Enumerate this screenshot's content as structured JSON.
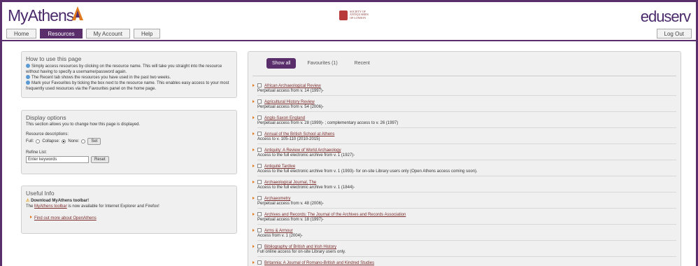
{
  "header": {
    "logo_text": "MyAthens",
    "society_lines": [
      "SOCIETY OF",
      "ANTIQUARIES",
      "OF LONDON"
    ],
    "eduserv_text": "eduserv"
  },
  "nav": {
    "tabs": [
      {
        "label": "Home",
        "active": false
      },
      {
        "label": "Resources",
        "active": true
      },
      {
        "label": "My Account",
        "active": false
      },
      {
        "label": "Help",
        "active": false
      }
    ],
    "logout_label": "Log Out"
  },
  "how_to": {
    "title": "How to use this page",
    "items": [
      "Simply access resources by clicking on the resource name. This will take you straight into the resource without having to specify a username/password again.",
      "The Recent tab shows the resources you have used in the past two weeks.",
      "Mark your Favourites by ticking the box next to the resource name. This enables easy access to your most frequently used resources via the Favourites panel on the home page."
    ]
  },
  "display_options": {
    "title": "Display options",
    "subtitle": "This section allows you to change how this page is displayed.",
    "descriptions_label": "Resource descriptions:",
    "full_label": "Full:",
    "collapse_label": "Collapse:",
    "none_label": "None:",
    "set_button": "Set",
    "refine_label": "Refine List:",
    "refine_placeholder": "Enter keywords",
    "reset_button": "Reset"
  },
  "useful_info": {
    "title": "Useful Info",
    "download_title": "Download MyAthens toolbar!",
    "toolbar_line_prefix": "The ",
    "toolbar_link": "MyAthens toolbar",
    "toolbar_line_suffix": " is now available for Internet Explorer and Firefox!",
    "find_out_link": "Find out more about OpenAthens"
  },
  "resources": {
    "tabs": [
      {
        "label": "Show all",
        "active": true
      },
      {
        "label": "Favourites (1)",
        "active": false
      },
      {
        "label": "Recent",
        "active": false
      }
    ],
    "items": [
      {
        "title": "African Archaeological Review",
        "desc": "Perpetual access from v. 14 (1997)-"
      },
      {
        "title": "Agricultural History Review",
        "desc": "Perpetual access from v. 54 (2006)-"
      },
      {
        "title": "Anglo-Saxon England",
        "desc": "Perpetual access from v. 28 (1999)- ; complementary access to v. 26 (1997)"
      },
      {
        "title": "Annual of the British School at Athens",
        "desc": "Access to v. 105-110 (2010-2015)"
      },
      {
        "title": "Antiquity: A Review of World Archaeology",
        "desc": "Access to the full electronic archive from v. 1 (1927)-"
      },
      {
        "title": "Antiquité Tardive",
        "desc": "Access to the full electronic archive from v. 1 (1993)- for on-site Library users only (Open Athens access coming soon)."
      },
      {
        "title": "Archaeological Journal, The",
        "desc": "Access to the full electronic archive from v. 1 (1844)-"
      },
      {
        "title": "Archaeometry",
        "desc": "Perpetual access from v. 48 (2006)-"
      },
      {
        "title": "Archives and Records: The Journal of the Archives and Records Association",
        "desc": "Perpetual access from v. 18 (1997)-"
      },
      {
        "title": "Arms & Armour",
        "desc": "Access from v. 1 (2004)-"
      },
      {
        "title": "Bibliography of British and Irish History",
        "desc": "Full online access for on-site Library users only."
      },
      {
        "title": "Britannia: A Journal of Romano-British and Kindred Studies",
        "desc": "Perpetual access from v. 36 (2005)-"
      }
    ]
  }
}
